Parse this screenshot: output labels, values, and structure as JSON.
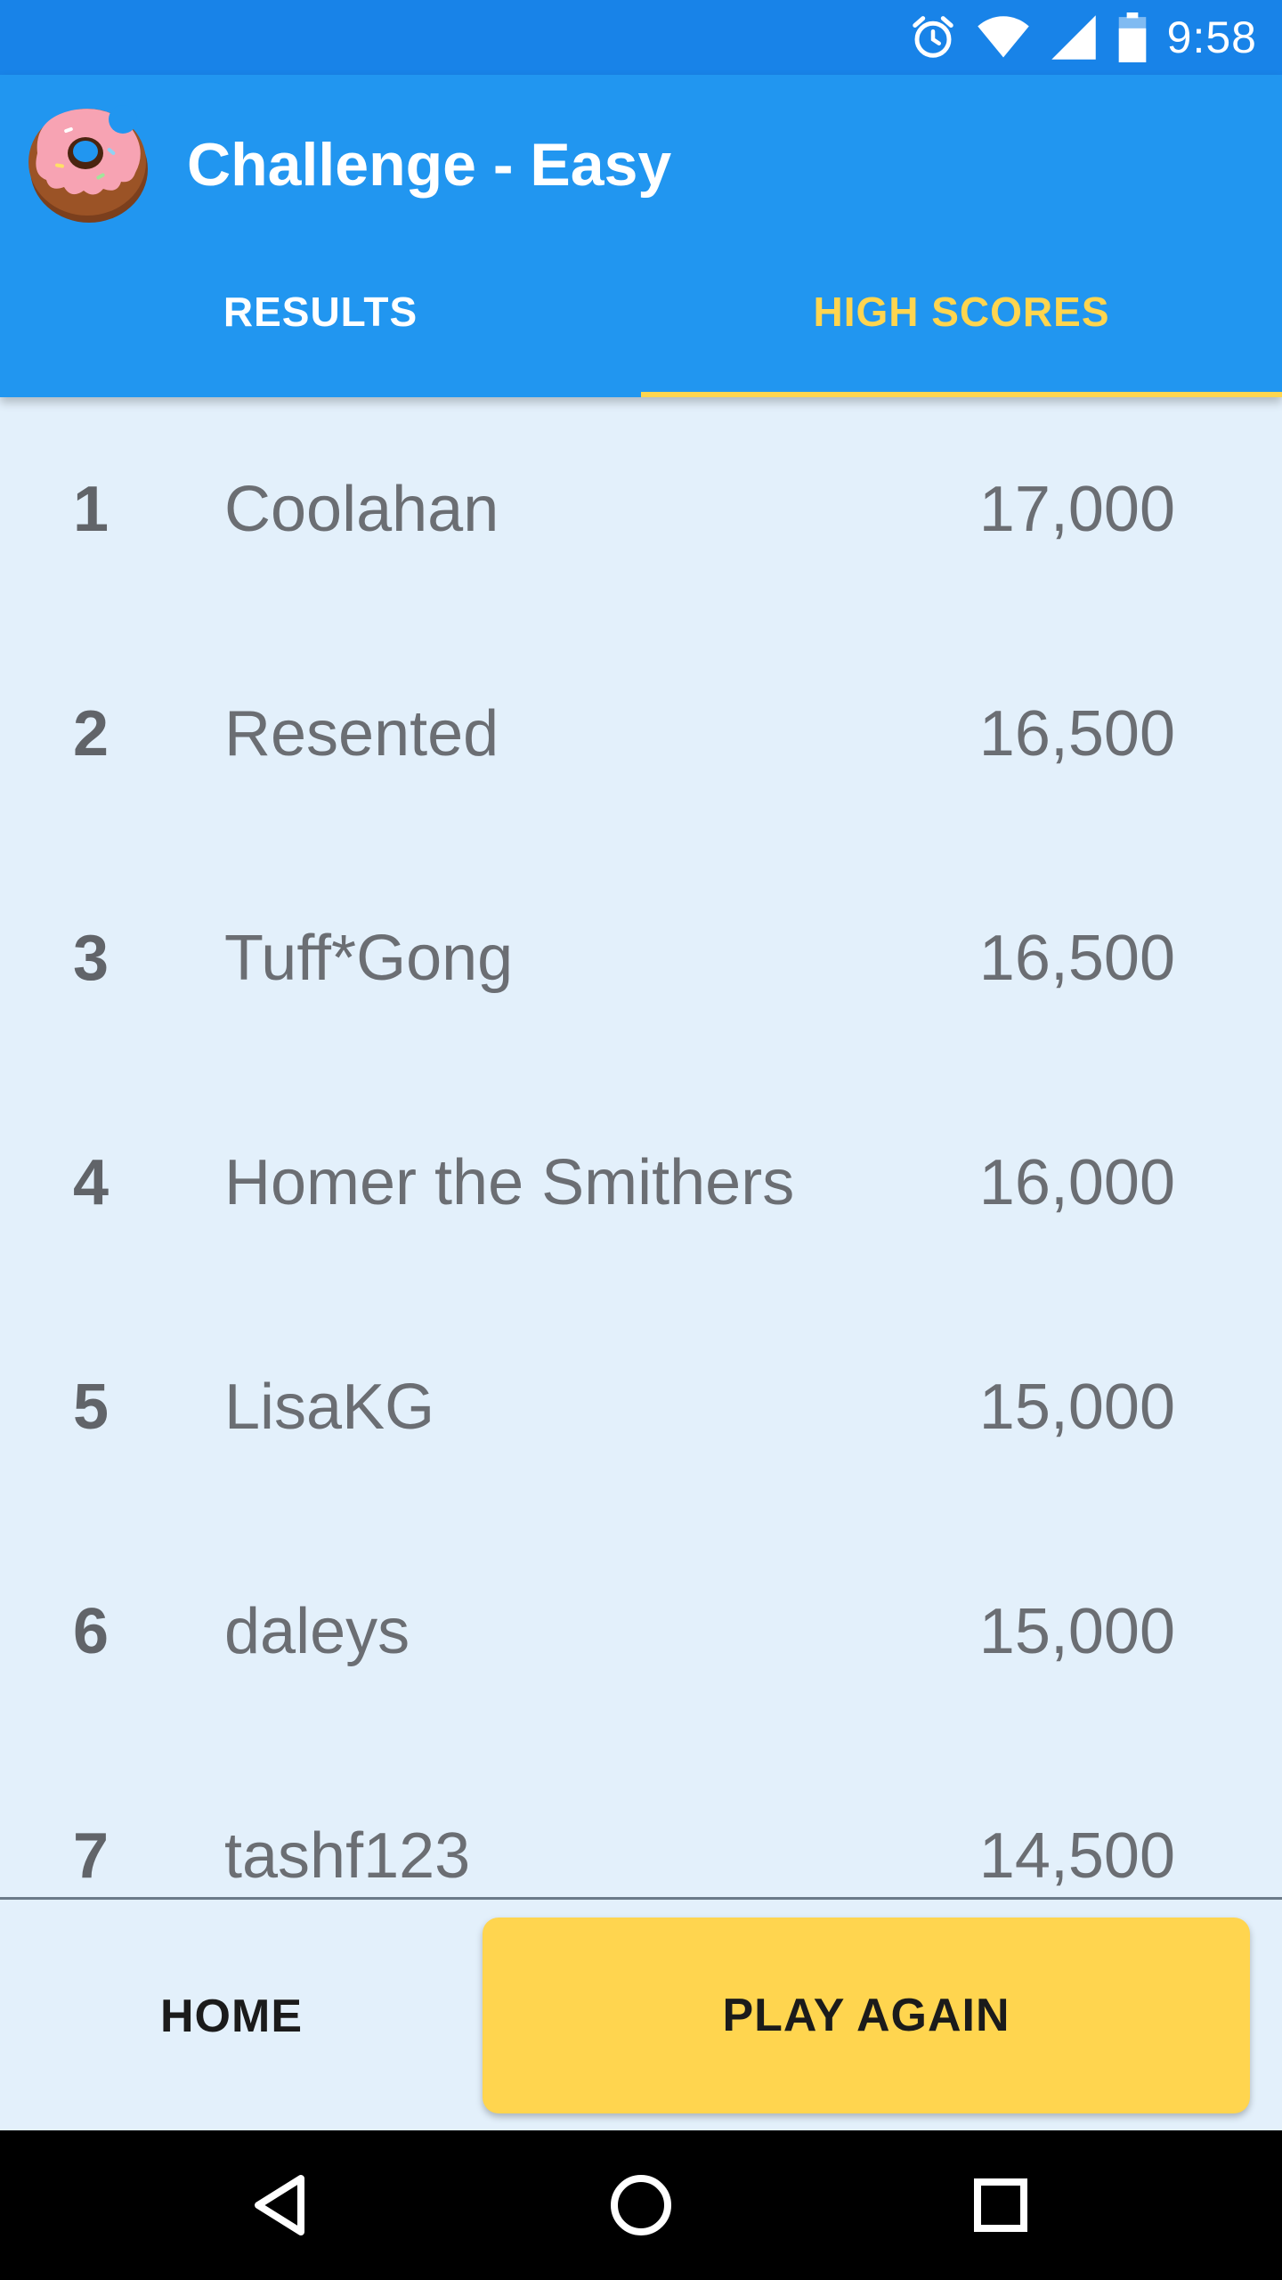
{
  "status_bar": {
    "time": "9:58",
    "icons": [
      "alarm-icon",
      "wifi-icon",
      "cell-signal-icon",
      "battery-icon"
    ]
  },
  "app_bar": {
    "title": "Challenge - Easy",
    "logo_icon": "donut-icon"
  },
  "tabs": [
    {
      "label": "RESULTS",
      "selected": false
    },
    {
      "label": "HIGH SCORES",
      "selected": true
    }
  ],
  "high_scores": [
    {
      "rank": "1",
      "name": "Coolahan",
      "score": "17,000"
    },
    {
      "rank": "2",
      "name": "Resented",
      "score": "16,500"
    },
    {
      "rank": "3",
      "name": "Tuff*Gong",
      "score": "16,500"
    },
    {
      "rank": "4",
      "name": "Homer the Smithers",
      "score": "16,000"
    },
    {
      "rank": "5",
      "name": "LisaKG",
      "score": "15,000"
    },
    {
      "rank": "6",
      "name": "daleys",
      "score": "15,000"
    },
    {
      "rank": "7",
      "name": "tashf123",
      "score": "14,500"
    }
  ],
  "bottom_bar": {
    "home_label": "HOME",
    "play_again_label": "PLAY AGAIN"
  },
  "nav_bar": {
    "icons": [
      "back-icon",
      "home-icon",
      "recents-icon"
    ]
  },
  "colors": {
    "status_bar": "#1883E8",
    "app_bar": "#2196F0",
    "accent": "#FFD54F",
    "list_background": "#E3F0FB",
    "text_gray": "#6B6E73"
  }
}
